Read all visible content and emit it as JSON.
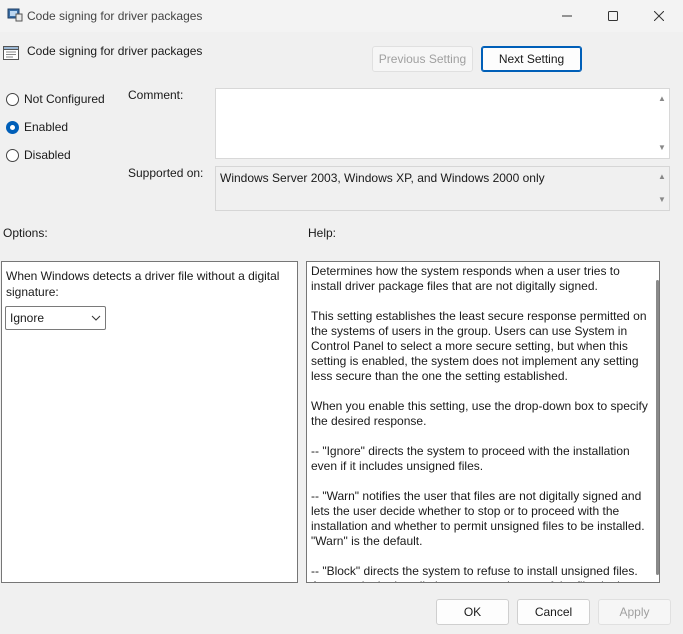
{
  "window": {
    "title": "Code signing for driver packages",
    "minimize_icon": "minimize-icon",
    "maximize_icon": "maximize-icon",
    "close_icon": "close-icon"
  },
  "header": {
    "title": "Code signing for driver packages",
    "previous_label": "Previous Setting",
    "next_label": "Next Setting"
  },
  "state": {
    "options": [
      {
        "label": "Not Configured",
        "checked": false
      },
      {
        "label": "Enabled",
        "checked": true
      },
      {
        "label": "Disabled",
        "checked": false
      }
    ]
  },
  "comment": {
    "label": "Comment:",
    "value": ""
  },
  "supported": {
    "label": "Supported on:",
    "value": "Windows Server 2003, Windows XP, and Windows 2000 only"
  },
  "options_panel": {
    "heading": "Options:",
    "prompt": "When Windows detects a driver file without a digital signature:",
    "selected": "Ignore"
  },
  "help_panel": {
    "heading": "Help:",
    "paragraphs": [
      "Determines how the system responds when a user tries to install driver package files that are not digitally signed.",
      "This setting establishes the least secure response permitted on the systems of users in the group. Users can use System in Control Panel to select a more secure setting, but when this setting is enabled, the system does not implement any setting less secure than the one the setting established.",
      "When you enable this setting, use the drop-down box to specify the desired response.",
      "--   \"Ignore\" directs the system to proceed with the installation even if it includes unsigned files.",
      "--   \"Warn\" notifies the user that files are not digitally signed and lets the user decide whether to stop or to proceed with the installation and whether to permit unsigned files to be installed. \"Warn\" is the default.",
      "--   \"Block\" directs the system to refuse to install unsigned files. As a result, the installation stops, and none of the files in the driver package are installed."
    ]
  },
  "footer": {
    "ok": "OK",
    "cancel": "Cancel",
    "apply": "Apply"
  }
}
